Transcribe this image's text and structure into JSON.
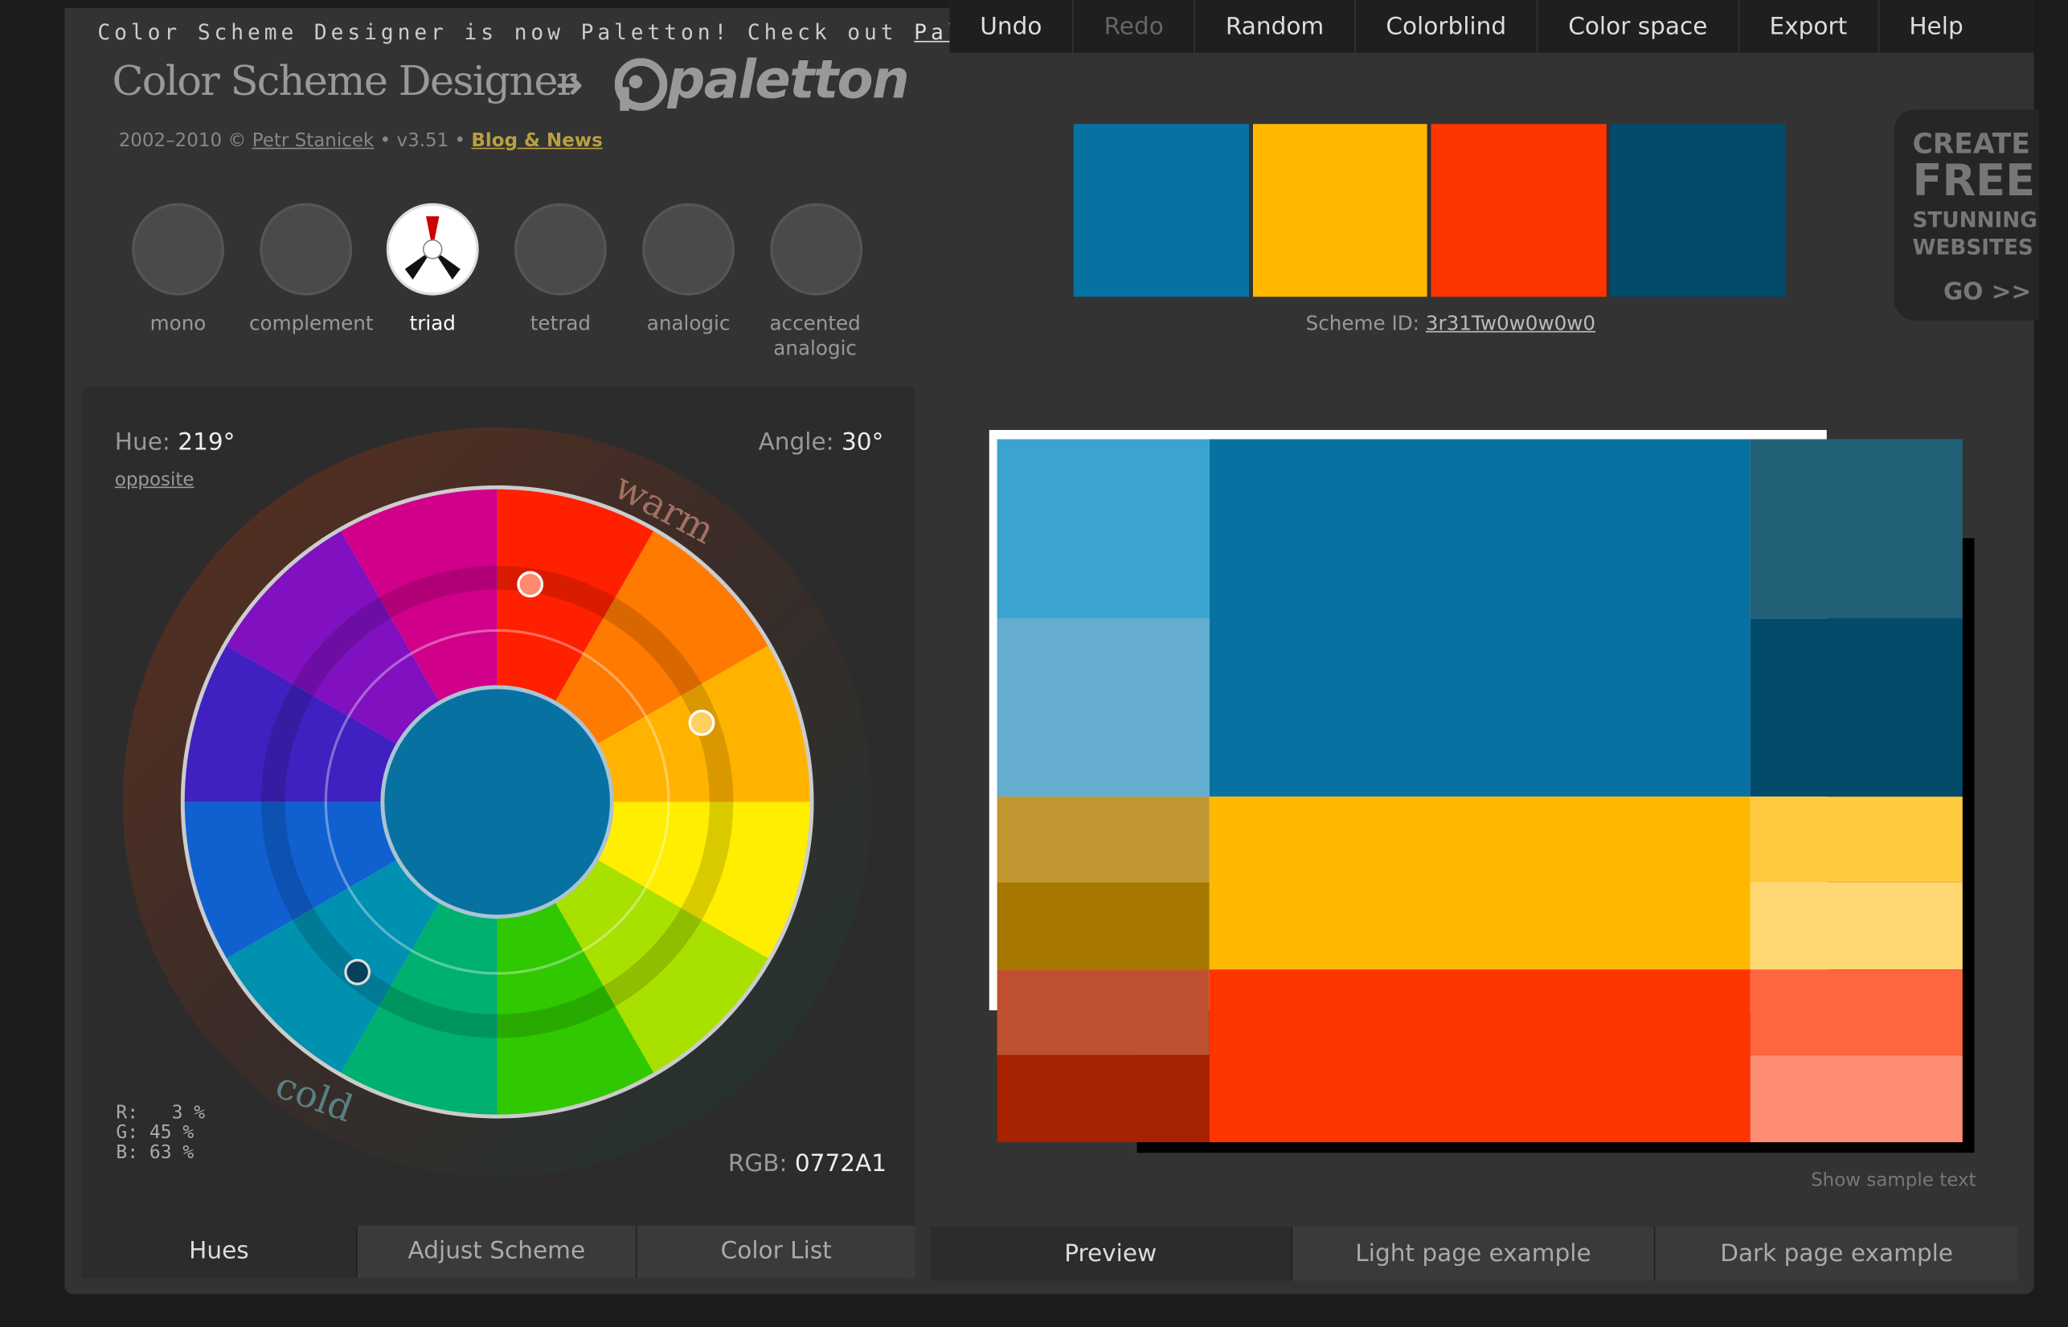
{
  "banner": {
    "text": "Color Scheme Designer is now Paletton! Check out ",
    "link": "Paletton.com"
  },
  "menu": [
    "Undo",
    "Redo",
    "Random",
    "Colorblind",
    "Color space",
    "Export",
    "Help"
  ],
  "menu_disabled": "Redo",
  "logo": {
    "old_name": "Color Scheme Designer",
    "arrow": "➜",
    "new_name": "paletton"
  },
  "credits": {
    "years": "2002–2010 © ",
    "author": "Petr Stanicek",
    "version": " • v3.51 • ",
    "blog": "Blog & News"
  },
  "schemes": [
    {
      "label": "mono"
    },
    {
      "label": "complement"
    },
    {
      "label": "triad",
      "selected": true
    },
    {
      "label": "tetrad"
    },
    {
      "label": "analogic"
    },
    {
      "label": "accented",
      "label2": "analogic"
    }
  ],
  "swatches": [
    "#0772A1",
    "#FFB800",
    "#FF3500",
    "#034B6B"
  ],
  "scheme_id": {
    "label": "Scheme ID: ",
    "value": "3r31Tw0w0w0w0"
  },
  "ad": {
    "line1": "CREATE",
    "line2": "FREE",
    "line3": "STUNNING",
    "line4": "WEBSITES",
    "line5": "GO >>"
  },
  "wheel": {
    "hue_label": "Hue:",
    "hue_value": "219°",
    "angle_label": "Angle:",
    "angle_value": "30°",
    "opposite": "opposite",
    "warm": "warm",
    "cold": "cold",
    "r": "R:   3 %",
    "g": "G: 45 %",
    "b": "B: 63 %",
    "rgb_label": "RGB:",
    "rgb_value": "0772A1",
    "center_color": "#0772A1"
  },
  "left_tabs": [
    "Hues",
    "Adjust Scheme",
    "Color List"
  ],
  "right_tabs": [
    "Preview",
    "Light page example",
    "Dark page example"
  ],
  "show_sample_text": "Show sample text",
  "preview": {
    "primary": {
      "main": "#0772A1",
      "light1": "#3AA3D0",
      "light2": "#64ADCE",
      "dark1": "#226078",
      "dark2": "#034B6B"
    },
    "secondary_a": {
      "main": "#FFB800",
      "left1": "#BF9630",
      "left2": "#A67800",
      "right1": "#FFCA40",
      "right2": "#FFD873"
    },
    "secondary_b": {
      "main": "#FF3500",
      "left1": "#BF5030",
      "left2": "#A62200",
      "right1": "#FF6740",
      "right2": "#FF8D73"
    }
  }
}
